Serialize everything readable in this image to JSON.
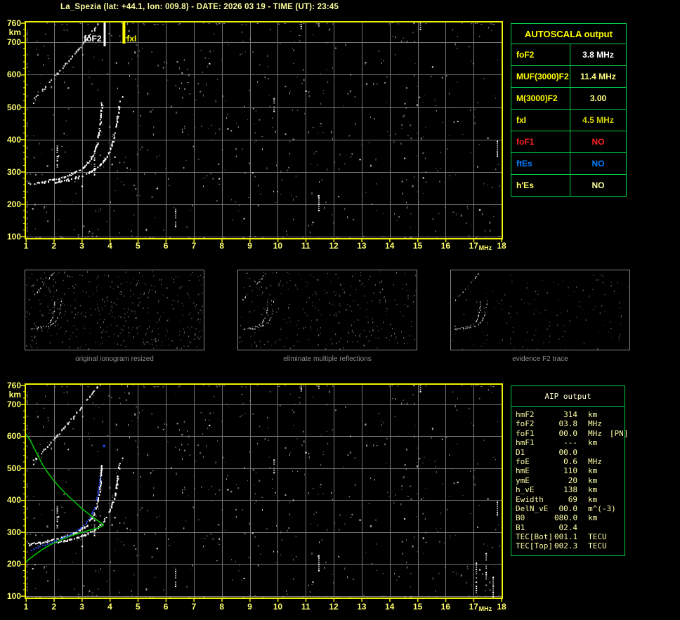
{
  "title": "La_Spezia (lat: +44.1, lon: 009.8) - DATE: 2026 03 19 - TIME (UT): 23:45",
  "colors": {
    "background": "#000000",
    "plot_border": "#f2f200",
    "axis_label": "#ffff6e",
    "grid": "#767676",
    "trace_white": "#ffffff",
    "table_border": "#00cc44",
    "label_yellow": "#ffff00",
    "value_pale_yellow": "#ffff82",
    "value_white": "#ffffff",
    "value_dark_yellow": "#cfcf00",
    "alert_red": "#ff2222",
    "alert_blue": "#0080ff",
    "aip_text": "#ffffa8",
    "caption_gray": "#8f8f8f",
    "profile_green": "#00c400",
    "restored_blue": "#2b4bff"
  },
  "axes": {
    "x_ticks": [
      1,
      2,
      3,
      4,
      5,
      6,
      7,
      8,
      9,
      10,
      11,
      12,
      13,
      14,
      15,
      16,
      17,
      18
    ],
    "x_unit": "MHz",
    "y_ticks": [
      760,
      700,
      600,
      500,
      400,
      300,
      200,
      100
    ],
    "y_unit": "km"
  },
  "markers": {
    "foF2": {
      "label": "foF2",
      "freq": 3.8,
      "color": "#ffffff"
    },
    "fxI": {
      "label": "fxI",
      "freq": 4.5,
      "color": "#ffff00"
    }
  },
  "autoscala": {
    "title": "AUTOSCALA output",
    "rows": [
      {
        "label": "foF2",
        "value": "3.8 MHz",
        "lc": "#ffff00",
        "vc": "#ffffff"
      },
      {
        "label": "MUF(3000)F2",
        "value": "11.4 MHz",
        "lc": "#ffff00",
        "vc": "#ffff82"
      },
      {
        "label": "M(3000)F2",
        "value": "3.00",
        "lc": "#ffff00",
        "vc": "#ffff82"
      },
      {
        "label": "fxI",
        "value": "4.5 MHz",
        "lc": "#ffff00",
        "vc": "#cfcf00"
      },
      {
        "label": "foF1",
        "value": "NO",
        "lc": "#ff2222",
        "vc": "#ff2222"
      },
      {
        "label": "ftEs",
        "value": "NO",
        "lc": "#0080ff",
        "vc": "#0080ff"
      },
      {
        "label": "h'Es",
        "value": "NO",
        "lc": "#ffff60",
        "vc": "#ffffa0"
      }
    ]
  },
  "aip": {
    "title": "AIP output",
    "rows": [
      {
        "name": "hmF2",
        "value": "314",
        "unit": "km",
        "note": ""
      },
      {
        "name": "foF2",
        "value": "03.8",
        "unit": "MHz",
        "note": ""
      },
      {
        "name": "foF1",
        "value": "00.0",
        "unit": "MHz",
        "note": "[PN]"
      },
      {
        "name": "hmF1",
        "value": "---",
        "unit": "km",
        "note": ""
      },
      {
        "name": "D1",
        "value": "00.0",
        "unit": "",
        "note": ""
      },
      {
        "name": "foE",
        "value": "0.6",
        "unit": "MHz",
        "note": ""
      },
      {
        "name": "hmE",
        "value": "110",
        "unit": "km",
        "note": ""
      },
      {
        "name": "ymE",
        "value": "20",
        "unit": "km",
        "note": ""
      },
      {
        "name": "h_vE",
        "value": "138",
        "unit": "km",
        "note": ""
      },
      {
        "name": "Ewidth",
        "value": "69",
        "unit": "km",
        "note": ""
      },
      {
        "name": "DelN_vE",
        "value": "00.0",
        "unit": "m^(-3)",
        "note": ""
      },
      {
        "name": "B0",
        "value": "080.0",
        "unit": "km",
        "note": ""
      },
      {
        "name": "B1",
        "value": "02.4",
        "unit": "",
        "note": ""
      },
      {
        "name": "TEC[Bot]",
        "value": "001.1",
        "unit": "TECU",
        "note": ""
      },
      {
        "name": "TEC[Top]",
        "value": "002.3",
        "unit": "TECU",
        "note": ""
      }
    ]
  },
  "thumbnails": [
    {
      "caption": "original ionogram resized"
    },
    {
      "caption": "eliminate multiple reflections"
    },
    {
      "caption": "evidence F2 trace"
    }
  ],
  "chart_data": {
    "type": "scatter",
    "x_axis": {
      "label": "MHz",
      "range": [
        1,
        18
      ]
    },
    "y_axis": {
      "label": "km",
      "range": [
        100,
        760
      ]
    },
    "series": [
      {
        "name": "f2_ordinary_trace",
        "points": [
          [
            1.15,
            262
          ],
          [
            1.45,
            266
          ],
          [
            1.75,
            271
          ],
          [
            2.05,
            277
          ],
          [
            2.35,
            284
          ],
          [
            2.65,
            293
          ],
          [
            2.95,
            305
          ],
          [
            3.15,
            319
          ],
          [
            3.32,
            337
          ],
          [
            3.46,
            360
          ],
          [
            3.56,
            390
          ],
          [
            3.63,
            425
          ],
          [
            3.67,
            458
          ],
          [
            3.7,
            492
          ],
          [
            3.72,
            518
          ]
        ]
      },
      {
        "name": "f2_extraordinary_trace",
        "points": [
          [
            2.05,
            268
          ],
          [
            2.35,
            272
          ],
          [
            2.65,
            278
          ],
          [
            2.95,
            286
          ],
          [
            3.25,
            297
          ],
          [
            3.55,
            312
          ],
          [
            3.78,
            332
          ],
          [
            3.97,
            357
          ],
          [
            4.1,
            387
          ],
          [
            4.2,
            420
          ],
          [
            4.27,
            455
          ],
          [
            4.32,
            490
          ],
          [
            4.35,
            522
          ]
        ]
      },
      {
        "name": "second_hop_reflection",
        "points": [
          [
            1.25,
            520
          ],
          [
            1.55,
            548
          ],
          [
            1.85,
            577
          ],
          [
            2.15,
            606
          ],
          [
            2.45,
            636
          ],
          [
            2.75,
            666
          ],
          [
            3.05,
            697
          ],
          [
            3.3,
            726
          ],
          [
            3.5,
            748
          ],
          [
            3.68,
            764
          ]
        ]
      },
      {
        "name": "electron_density_profile",
        "points": [
          [
            1.0,
            208
          ],
          [
            1.3,
            228
          ],
          [
            1.6,
            247
          ],
          [
            1.9,
            262
          ],
          [
            2.2,
            274
          ],
          [
            2.5,
            285
          ],
          [
            2.8,
            294
          ],
          [
            3.1,
            302
          ],
          [
            3.35,
            308
          ],
          [
            3.55,
            313
          ],
          [
            3.68,
            317
          ],
          [
            3.76,
            321
          ],
          [
            3.76,
            325
          ],
          [
            3.6,
            334
          ],
          [
            3.4,
            346
          ],
          [
            3.2,
            360
          ],
          [
            3.0,
            374
          ],
          [
            2.8,
            390
          ],
          [
            2.6,
            406
          ],
          [
            2.4,
            423
          ],
          [
            2.2,
            441
          ],
          [
            2.0,
            461
          ],
          [
            1.8,
            484
          ],
          [
            1.6,
            510
          ],
          [
            1.45,
            536
          ],
          [
            1.3,
            562
          ],
          [
            1.15,
            588
          ],
          [
            1.0,
            608
          ]
        ]
      },
      {
        "name": "restored_trace",
        "points": [
          [
            1.1,
            240
          ],
          [
            1.35,
            249
          ],
          [
            1.6,
            257
          ],
          [
            1.85,
            265
          ],
          [
            2.1,
            274
          ],
          [
            2.35,
            283
          ],
          [
            2.6,
            294
          ],
          [
            2.85,
            306
          ],
          [
            3.05,
            319
          ],
          [
            3.2,
            333
          ],
          [
            3.33,
            350
          ],
          [
            3.43,
            370
          ],
          [
            3.51,
            393
          ],
          [
            3.57,
            417
          ],
          [
            3.62,
            442
          ],
          [
            3.65,
            462
          ],
          [
            3.67,
            478
          ]
        ],
        "extra_point": [
          3.78,
          571
        ]
      }
    ],
    "rfi_streaks": {
      "shared": [
        [
          2.12,
          312,
          382
        ],
        [
          3.45,
          290,
          358
        ],
        [
          6.35,
          128,
          192
        ],
        [
          9.87,
          480,
          528
        ],
        [
          11.47,
          180,
          228
        ],
        [
          11.47,
          750,
          766
        ],
        [
          10.84,
          732,
          764
        ],
        [
          15.1,
          736,
          762
        ],
        [
          17.85,
          350,
          396
        ]
      ],
      "bottom_extra": [
        [
          17.1,
          110,
          205
        ],
        [
          17.45,
          130,
          235
        ],
        [
          17.7,
          95,
          160
        ]
      ]
    }
  }
}
